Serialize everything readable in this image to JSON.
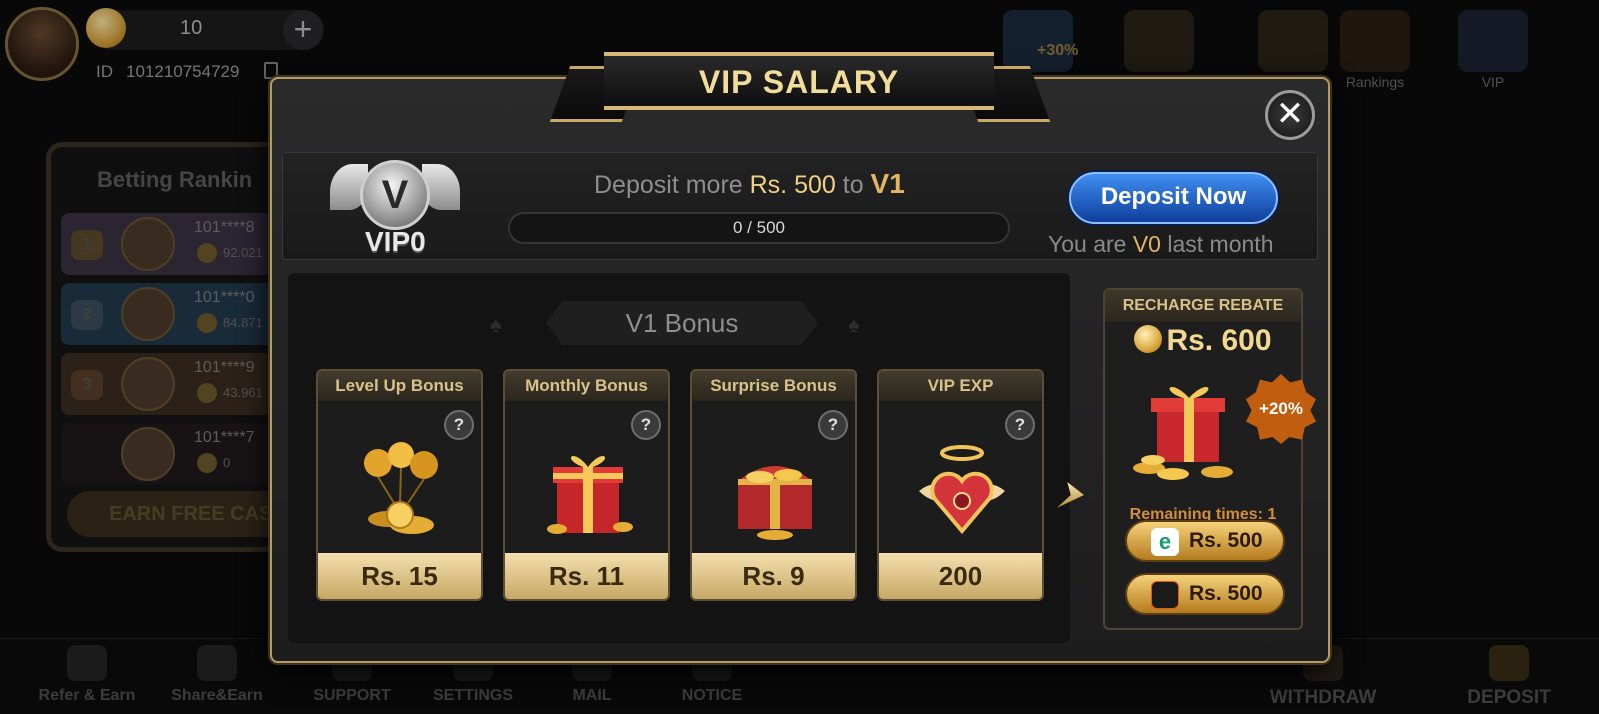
{
  "header": {
    "coin_balance": "10",
    "id_label": "ID",
    "user_id": "101210754729",
    "top_icons": [
      {
        "name": "promo-bonus",
        "label": "",
        "badge": "+30%"
      },
      {
        "name": "trophy",
        "label": ""
      },
      {
        "name": "paper-plane",
        "label": ""
      },
      {
        "name": "rankings",
        "label": "Rankings"
      },
      {
        "name": "vip",
        "label": "VIP"
      }
    ]
  },
  "ranking": {
    "title": "Betting Rankin",
    "rows": [
      {
        "rank": "1",
        "name": "101****8",
        "score": "92.021"
      },
      {
        "rank": "2",
        "name": "101****0",
        "score": "84.871"
      },
      {
        "rank": "3",
        "name": "101****9",
        "score": "43.961"
      },
      {
        "rank": "",
        "name": "101****7",
        "score": "0"
      }
    ],
    "earn_button": "EARN FREE CASH"
  },
  "bottom_nav": [
    {
      "label": "Refer & Earn"
    },
    {
      "label": "Share&Earn"
    },
    {
      "label": "SUPPORT"
    },
    {
      "label": "SETTINGS"
    },
    {
      "label": "MAIL"
    },
    {
      "label": "NOTICE"
    },
    {
      "label": "WITHDRAW"
    },
    {
      "label": "DEPOSIT"
    }
  ],
  "modal": {
    "title": "VIP SALARY",
    "close_label": "✕",
    "vip": {
      "level": "VIP0",
      "deposit_prefix": "Deposit more ",
      "deposit_amount": "Rs. 500",
      "deposit_mid": " to ",
      "target_level": "V1",
      "progress_text": "0 / 500",
      "progress": 0,
      "deposit_button": "Deposit Now",
      "month_prefix": "You are ",
      "month_level": "V0",
      "month_suffix": " last month"
    },
    "bonus": {
      "header": "V1 Bonus",
      "cards": [
        {
          "title": "Level Up Bonus",
          "value": "Rs. 15",
          "icon": "balloons-coins-icon"
        },
        {
          "title": "Monthly Bonus",
          "value": "Rs. 11",
          "icon": "gift-box-icon"
        },
        {
          "title": "Surprise Bonus",
          "value": "Rs. 9",
          "icon": "treasure-chest-icon"
        },
        {
          "title": "VIP EXP",
          "value": "200",
          "icon": "winged-heart-icon"
        }
      ],
      "help_label": "?"
    },
    "rebate": {
      "title": "RECHARGE REBATE",
      "amount": "Rs. 600",
      "badge": "+20%",
      "remaining": "Remaining times: 1",
      "pay_buttons": [
        {
          "label": "Rs. 500",
          "icon": "easypaisa-icon"
        },
        {
          "label": "Rs. 500",
          "icon": "wallet-icon"
        }
      ]
    }
  }
}
